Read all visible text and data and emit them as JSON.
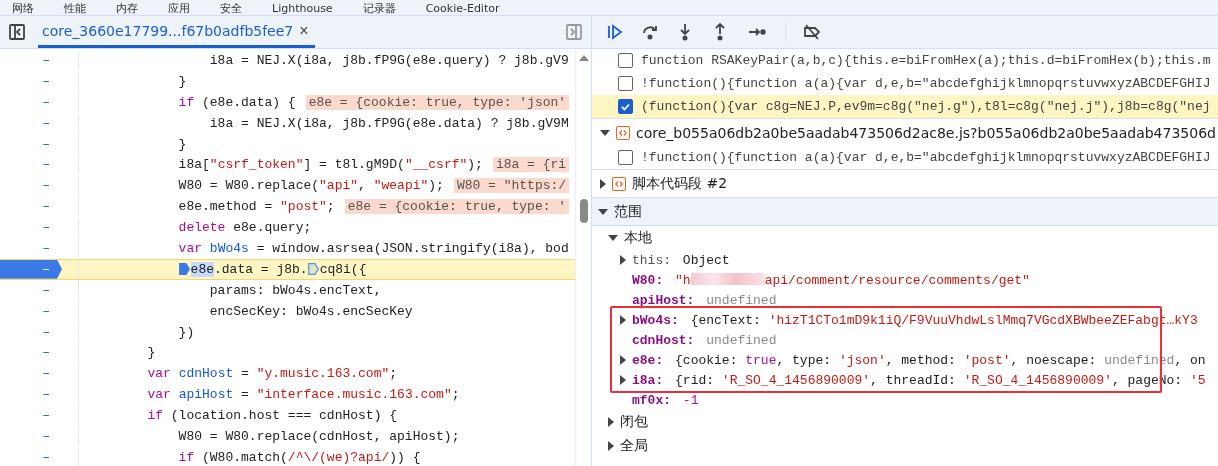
{
  "top_tabs": [
    "网络",
    "性能",
    "内存",
    "应用",
    "安全",
    "Lighthouse",
    "记录器",
    "Cookie-Editor"
  ],
  "editor": {
    "file_tab": {
      "label": "core_3660e17799...f67b0adfb5fee7",
      "close": "×",
      "selected": true
    },
    "lines": [
      {
        "gutter": "–",
        "breakpoint": false,
        "paused": false,
        "tokens": [
          {
            "kind": "plain",
            "text": "                i8a = NEJ.X(i8a, j8b.fP9G(e8e.query) ? j8b.gV9"
          }
        ]
      },
      {
        "gutter": "–",
        "breakpoint": false,
        "paused": false,
        "tokens": [
          {
            "kind": "plain",
            "text": "            }"
          }
        ]
      },
      {
        "gutter": "–",
        "breakpoint": false,
        "paused": false,
        "tokens": [
          {
            "kind": "kw",
            "text": "            if"
          },
          {
            "kind": "plain",
            "text": " (e8e.data) {"
          }
        ],
        "inline_value": "e8e = {cookie: true, type: 'json'"
      },
      {
        "gutter": "–",
        "breakpoint": false,
        "paused": false,
        "tokens": [
          {
            "kind": "plain",
            "text": "                i8a = NEJ.X(i8a, j8b.fP9G(e8e.data) ? j8b.gV9M"
          }
        ]
      },
      {
        "gutter": "–",
        "breakpoint": false,
        "paused": false,
        "tokens": [
          {
            "kind": "plain",
            "text": "            }"
          }
        ]
      },
      {
        "gutter": "–",
        "breakpoint": false,
        "paused": false,
        "tokens": [
          {
            "kind": "plain",
            "text": "            i8a["
          },
          {
            "kind": "str",
            "text": "\"csrf_token\""
          },
          {
            "kind": "plain",
            "text": "] = t8l.gM9D("
          },
          {
            "kind": "str",
            "text": "\"__csrf\""
          },
          {
            "kind": "plain",
            "text": ");"
          }
        ],
        "inline_value": "i8a = {ri"
      },
      {
        "gutter": "–",
        "breakpoint": false,
        "paused": false,
        "tokens": [
          {
            "kind": "plain",
            "text": "            W80 = W80.replace("
          },
          {
            "kind": "str",
            "text": "\"api\""
          },
          {
            "kind": "plain",
            "text": ", "
          },
          {
            "kind": "str",
            "text": "\"weapi\""
          },
          {
            "kind": "plain",
            "text": ");"
          }
        ],
        "inline_value": "W80 = \"https:/"
      },
      {
        "gutter": "–",
        "breakpoint": false,
        "paused": false,
        "tokens": [
          {
            "kind": "plain",
            "text": "            e8e.method = "
          },
          {
            "kind": "str",
            "text": "\"post\""
          },
          {
            "kind": "plain",
            "text": ";"
          }
        ],
        "inline_value": "e8e = {cookie: true, type: '"
      },
      {
        "gutter": "–",
        "breakpoint": false,
        "paused": false,
        "tokens": [
          {
            "kind": "kw",
            "text": "            delete"
          },
          {
            "kind": "plain",
            "text": " e8e.query;"
          }
        ]
      },
      {
        "gutter": "–",
        "breakpoint": false,
        "paused": false,
        "tokens": [
          {
            "kind": "kw",
            "text": "            var"
          },
          {
            "kind": "def",
            "text": " bWo4s"
          },
          {
            "kind": "plain",
            "text": " = window.asrsea(JSON.stringify(i8a), bod"
          }
        ]
      },
      {
        "gutter": "–",
        "breakpoint": true,
        "paused": true,
        "tokens": [
          {
            "kind": "marker",
            "active": true
          },
          {
            "kind": "sel",
            "text": "e8e"
          },
          {
            "kind": "plain",
            "text": ".data = j8b."
          },
          {
            "kind": "marker",
            "active": false
          },
          {
            "kind": "plain",
            "text": "cq8i({"
          }
        ]
      },
      {
        "gutter": "–",
        "breakpoint": false,
        "paused": false,
        "tokens": [
          {
            "kind": "plain",
            "text": "                params: bWo4s.encText,"
          }
        ]
      },
      {
        "gutter": "–",
        "breakpoint": false,
        "paused": false,
        "tokens": [
          {
            "kind": "plain",
            "text": "                encSecKey: bWo4s.encSecKey"
          }
        ]
      },
      {
        "gutter": "–",
        "breakpoint": false,
        "paused": false,
        "tokens": [
          {
            "kind": "plain",
            "text": "            })"
          }
        ]
      },
      {
        "gutter": "–",
        "breakpoint": false,
        "paused": false,
        "tokens": [
          {
            "kind": "plain",
            "text": "        }"
          }
        ]
      },
      {
        "gutter": "–",
        "breakpoint": false,
        "paused": false,
        "tokens": [
          {
            "kind": "kw",
            "text": "        var"
          },
          {
            "kind": "def",
            "text": " cdnHost"
          },
          {
            "kind": "plain",
            "text": " = "
          },
          {
            "kind": "str",
            "text": "\"y.music.163.com\""
          },
          {
            "kind": "plain",
            "text": ";"
          }
        ]
      },
      {
        "gutter": "–",
        "breakpoint": false,
        "paused": false,
        "tokens": [
          {
            "kind": "kw",
            "text": "        var"
          },
          {
            "kind": "def",
            "text": " apiHost"
          },
          {
            "kind": "plain",
            "text": " = "
          },
          {
            "kind": "str",
            "text": "\"interface.music.163.com\""
          },
          {
            "kind": "plain",
            "text": ";"
          }
        ]
      },
      {
        "gutter": "–",
        "breakpoint": false,
        "paused": false,
        "tokens": [
          {
            "kind": "kw",
            "text": "        if"
          },
          {
            "kind": "plain",
            "text": " (location.host === cdnHost) {"
          }
        ]
      },
      {
        "gutter": "–",
        "breakpoint": false,
        "paused": false,
        "tokens": [
          {
            "kind": "plain",
            "text": "            W80 = W80.replace(cdnHost, apiHost);"
          }
        ]
      },
      {
        "gutter": "–",
        "breakpoint": false,
        "paused": false,
        "tokens": [
          {
            "kind": "kw",
            "text": "            if"
          },
          {
            "kind": "plain",
            "text": " (W80.match("
          },
          {
            "kind": "str",
            "text": "/^\\/(we)?api/"
          },
          {
            "kind": "plain",
            "text": ")) {"
          }
        ]
      }
    ]
  },
  "breakpoints": [
    {
      "items": [
        {
          "code": "function RSAKeyPair(a,b,c){this.e=biFromHex(a);this.d=biFromHex(b);this.m",
          "checked": false,
          "paused": false
        },
        {
          "code": "!function(){function a(a){var d,e,b=\"abcdefghijklmnopqrstuvwxyzABCDEFGHIJ",
          "checked": false,
          "paused": false
        },
        {
          "code": "(function(){var c8g=NEJ.P,ev9m=c8g(\"nej.g\"),t8l=c8g(\"nej.j\"),j8b=c8g(\"nej",
          "checked": true,
          "paused": true
        }
      ]
    },
    {
      "file": "core_b055a06db2a0be5aadab473506d2ac8e.js?b055a06db2a0be5aadab473506d",
      "expanded": true,
      "items": [
        {
          "code": "!function(){function a(a){var d,e,b=\"abcdefghijklmnopqrstuvwxyzABCDEFGHIJ",
          "checked": false,
          "paused": false
        }
      ]
    },
    {
      "file": "脚本代码段 #2",
      "expanded": false
    }
  ],
  "scope": {
    "title": "范围",
    "expanded": true,
    "groups": [
      {
        "name": "本地",
        "expanded": true,
        "vars": [
          {
            "key": "this:",
            "dim": true,
            "expandable": true,
            "annotated": false,
            "value": [
              {
                "kind": "plain",
                "text": "Object"
              }
            ]
          },
          {
            "key": "W80:",
            "dim": false,
            "expandable": false,
            "annotated": false,
            "value": [
              {
                "kind": "str",
                "text": "\"h"
              },
              {
                "kind": "redacted"
              },
              {
                "kind": "str",
                "text": "api/comment/resource/comments/get\""
              }
            ]
          },
          {
            "key": "apiHost:",
            "dim": false,
            "expandable": false,
            "annotated": false,
            "value": [
              {
                "kind": "undef",
                "text": "undefined"
              }
            ]
          },
          {
            "key": "bWo4s:",
            "dim": false,
            "expandable": true,
            "annotated": true,
            "value": [
              {
                "kind": "plain",
                "text": "{encText: "
              },
              {
                "kind": "str",
                "text": "'hizT1CTo1mD9k1iQ/F9VuuVhdwLslMmq7VGcdXBWbeeZEFabgt…kY3"
              }
            ]
          },
          {
            "key": "cdnHost:",
            "dim": false,
            "expandable": false,
            "annotated": true,
            "value": [
              {
                "kind": "undef",
                "text": "undefined"
              }
            ]
          },
          {
            "key": "e8e:",
            "dim": false,
            "expandable": true,
            "annotated": true,
            "value": [
              {
                "kind": "plain",
                "text": "{cookie: "
              },
              {
                "kind": "kw",
                "text": "true"
              },
              {
                "kind": "plain",
                "text": ", type: "
              },
              {
                "kind": "str",
                "text": "'json'"
              },
              {
                "kind": "plain",
                "text": ", method: "
              },
              {
                "kind": "str",
                "text": "'post'"
              },
              {
                "kind": "plain",
                "text": ", noescape: "
              },
              {
                "kind": "undef",
                "text": "undefined"
              },
              {
                "kind": "plain",
                "text": ", on"
              }
            ]
          },
          {
            "key": "i8a:",
            "dim": false,
            "expandable": true,
            "annotated": true,
            "value": [
              {
                "kind": "plain",
                "text": "{rid: "
              },
              {
                "kind": "str",
                "text": "'R_SO_4_1456890009'"
              },
              {
                "kind": "plain",
                "text": ", threadId: "
              },
              {
                "kind": "str",
                "text": "'R_SO_4_1456890009'"
              },
              {
                "kind": "plain",
                "text": ", pageNo: "
              },
              {
                "kind": "str",
                "text": "'5"
              }
            ]
          },
          {
            "key": "mf0x:",
            "dim": false,
            "expandable": false,
            "annotated": false,
            "value": [
              {
                "kind": "kw",
                "text": "-1"
              }
            ]
          }
        ]
      },
      {
        "name": "闭包",
        "expanded": false
      },
      {
        "name": "全局",
        "expanded": false
      }
    ]
  }
}
